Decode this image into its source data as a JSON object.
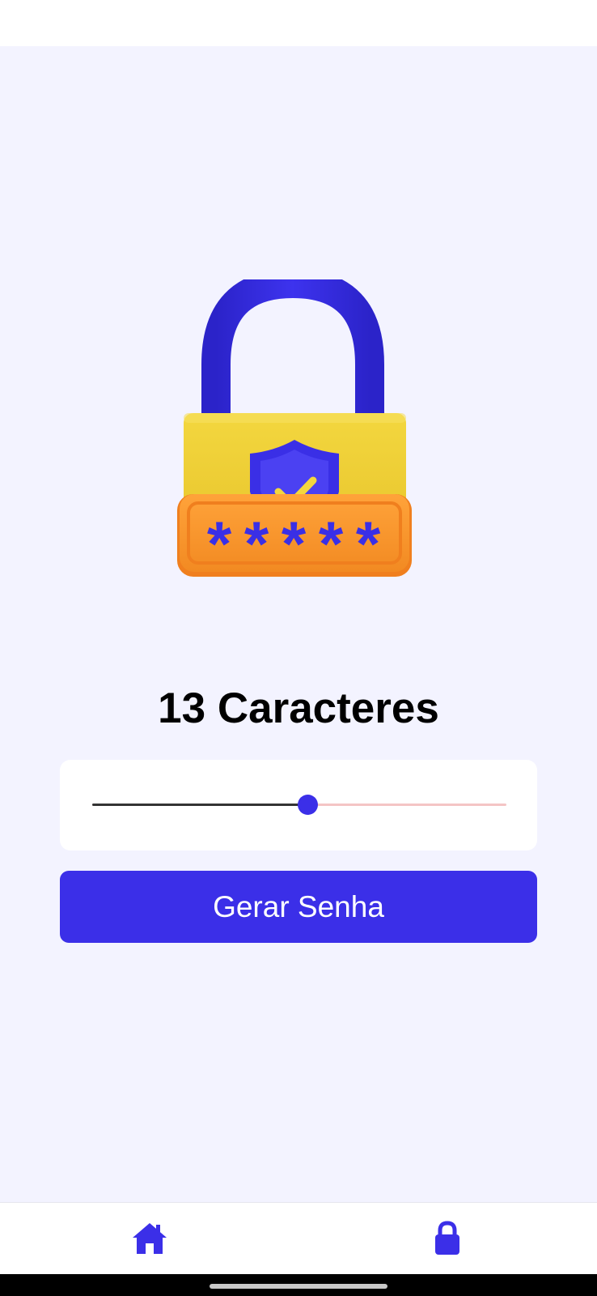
{
  "generator": {
    "length_label": "13 Caracteres",
    "length_value": 13,
    "slider_fraction": 0.52,
    "generate_button_label": "Gerar Senha"
  },
  "bottom_nav": {
    "items": [
      {
        "icon": "home-icon"
      },
      {
        "icon": "lock-icon"
      }
    ]
  },
  "colors": {
    "accent": "#3b2fe8",
    "background": "#f3f3ff",
    "lock_body": "#f0d23a",
    "lock_plate": "#f7942b",
    "slider_inactive": "#f4c5c5"
  }
}
